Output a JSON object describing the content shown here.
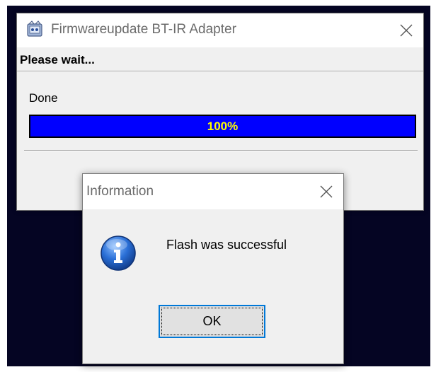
{
  "main_window": {
    "title": "Firmwareupdate BT-IR Adapter",
    "icon": "app-icon",
    "status_heading": "Please wait...",
    "progress_label": "Done",
    "progress": {
      "percent": 100,
      "text": "100%",
      "fill_color": "#0000ff",
      "text_color": "#ffff00"
    }
  },
  "info_dialog": {
    "title": "Information",
    "icon": "information-icon",
    "message": "Flash was successful",
    "ok_label": "OK"
  },
  "colors": {
    "desktop_background": "#050523",
    "accent": "#0078d7"
  }
}
